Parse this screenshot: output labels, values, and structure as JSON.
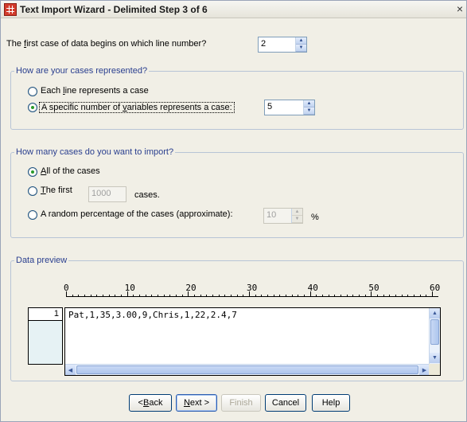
{
  "window": {
    "title": "Text Import Wizard - Delimited Step 3 of 6",
    "close_glyph": "×"
  },
  "first_line": {
    "label_pre": "The ",
    "label_u": "f",
    "label_post": "irst case of data begins on which line number?",
    "value": "2"
  },
  "cases_group": {
    "legend": "How are your cases represented?",
    "option_each_line_pre": "Each ",
    "option_each_line_u": "l",
    "option_each_line_post": "ine represents a case",
    "option_specific_pre": "A specific number of ",
    "option_specific_u": "v",
    "option_specific_post": "ariables represents a case:",
    "specific_value": "5",
    "selected": "specific"
  },
  "import_group": {
    "legend": "How many cases do you want to import?",
    "option_all_u": "A",
    "option_all_post": "ll of the cases",
    "option_first_u": "T",
    "option_first_post": "he first",
    "first_value": "1000",
    "first_suffix": "cases.",
    "option_random": "A random percentage of the cases (approximate):",
    "random_value": "10",
    "random_suffix": "%",
    "selected": "all"
  },
  "preview": {
    "legend": "Data preview",
    "ruler_labels": [
      "0",
      "10",
      "20",
      "30",
      "40",
      "50",
      "60"
    ],
    "rows": [
      {
        "num": "1",
        "text": "Pat,1,35,3.00,9,Chris,1,22,2.4,7"
      }
    ]
  },
  "buttons": {
    "back_pre": "< ",
    "back_u": "B",
    "back_post": "ack",
    "next_u": "N",
    "next_post": "ext >",
    "finish": "Finish",
    "cancel": "Cancel",
    "help": "Help"
  },
  "colors": {
    "group_legend": "#2a3f8f",
    "window_bg": "#f1efe6",
    "radio_selected": "#2a9a2a"
  }
}
